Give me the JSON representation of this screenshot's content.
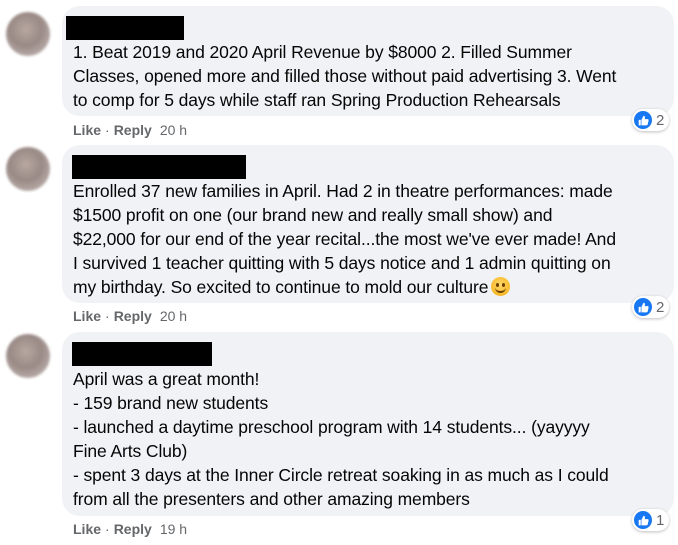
{
  "comments": [
    {
      "text": "1. Beat 2019 and 2020 April Revenue by $8000 2. Filled Summer\nClasses, opened more and filled those without paid advertising 3. Went\nto comp for 5 days while staff ran Spring Production Rehearsals",
      "like_label": "Like",
      "reply_label": "Reply",
      "time": "20 h",
      "reaction_count": "2",
      "reaction_icon": "like-icon"
    },
    {
      "text": "Enrolled 37 new families in April. Had 2 in theatre performances: made\n$1500 profit on one (our brand new and really small show) and\n$22,000 for our end of the year recital...the most we've ever made! And\nI survived 1 teacher quitting with 5 days notice and 1 admin quitting on\nmy birthday. So excited to continue to mold our culture",
      "emoji": "slightly-smiling-face-emoji",
      "like_label": "Like",
      "reply_label": "Reply",
      "time": "20 h",
      "reaction_count": "2",
      "reaction_icon": "like-icon"
    },
    {
      "text": "April was a great month!\n- 159 brand new students\n- launched a daytime preschool program with 14 students... (yayyyy\nFine Arts Club)\n- spent 3 days at the Inner Circle retreat soaking in as much as I could\nfrom all the presenters and other amazing members",
      "like_label": "Like",
      "reply_label": "Reply",
      "time": "19 h",
      "reaction_count": "1",
      "reaction_icon": "like-icon"
    }
  ],
  "colors": {
    "bubble": "#f0f2f5",
    "text": "#050505",
    "meta": "#65676b",
    "like_blue": "#1877f2",
    "redaction": "#000000"
  }
}
